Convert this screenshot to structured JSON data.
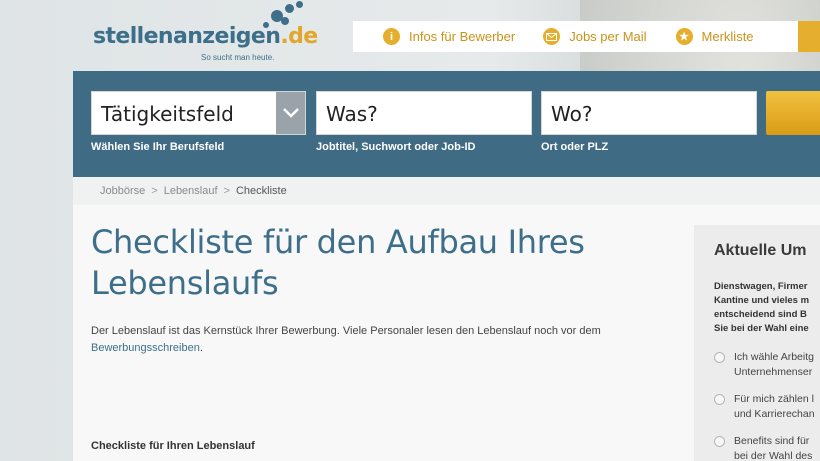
{
  "logo": {
    "name": "stellenanzeigen",
    "tld": ".de",
    "tagline": "So sucht man heute."
  },
  "top_links": [
    {
      "label": "Infos für Bewerber",
      "icon": "info-icon"
    },
    {
      "label": "Jobs per Mail",
      "icon": "mail-icon"
    },
    {
      "label": "Merkliste",
      "icon": "star-icon"
    }
  ],
  "search": {
    "category": {
      "value": "Tätigkeitsfeld",
      "hint": "Wählen Sie Ihr Berufsfeld"
    },
    "what": {
      "value": "Was?",
      "hint": "Jobtitel, Suchwort oder Job-ID"
    },
    "where": {
      "value": "Wo?",
      "hint": "Ort oder PLZ"
    }
  },
  "breadcrumb": {
    "items": [
      "Jobbörse",
      "Lebenslauf"
    ],
    "current": "Checkliste",
    "separator": ">"
  },
  "main": {
    "title": "Checkliste für den Aufbau Ihres Lebenslaufs",
    "intro_text": "Der Lebenslauf ist das Kernstück Ihrer Bewerbung. Viele Personaler lesen den Lebenslauf noch vor dem",
    "intro_link": "Bewerbungsschreiben",
    "intro_end": ".",
    "section_heading": "Checkliste für Ihren Lebenslauf"
  },
  "poll": {
    "title": "Aktuelle Um",
    "question_lines": [
      "Dienstwagen, Firmer",
      "Kantine und vieles m",
      "entscheidend sind B",
      "Sie bei der Wahl eine"
    ],
    "options": [
      [
        "Ich wähle Arbeitg",
        "Unternehmenser"
      ],
      [
        "Für mich zählen l",
        "und Karrierechan"
      ],
      [
        "Benefits sind für",
        "bei der Wahl des"
      ]
    ]
  },
  "colors": {
    "brand_blue": "#3d6f8a",
    "accent_gold": "#e5ae2c",
    "search_band": "#3f6b84"
  }
}
